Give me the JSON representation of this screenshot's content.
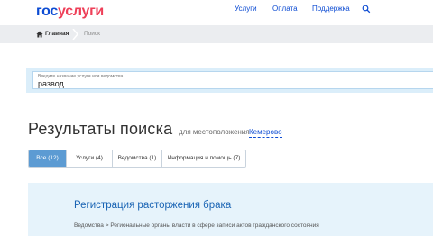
{
  "header": {
    "logo_gos": "гос",
    "logo_uslugi": "услуги",
    "nav": [
      "Услуги",
      "Оплата",
      "Поддержка"
    ],
    "search_icon": "search-icon"
  },
  "breadcrumb": {
    "home": "Главная",
    "current": "Поиск"
  },
  "search": {
    "placeholder": "Введите название услуги или ведомства",
    "value": "развод"
  },
  "results": {
    "title": "Результаты поиска",
    "location_prefix": "для местоположения",
    "location": "Кемерово"
  },
  "tabs": [
    {
      "label": "Все (12)",
      "active": true
    },
    {
      "label": "Услуги (4)",
      "active": false
    },
    {
      "label": "Ведомства (1)",
      "active": false
    },
    {
      "label": "Информация и помощь (7)",
      "active": false
    }
  ],
  "result_card": {
    "title": "Регистрация расторжения брака",
    "path": "Ведомства > Региональные органы власти в сфере записи актов гражданского состояния"
  },
  "colors": {
    "brand_blue": "#0d4cd3",
    "brand_red": "#ee3f58",
    "active_tab": "#5c9bd3",
    "card_bg": "#e6f3fb"
  }
}
